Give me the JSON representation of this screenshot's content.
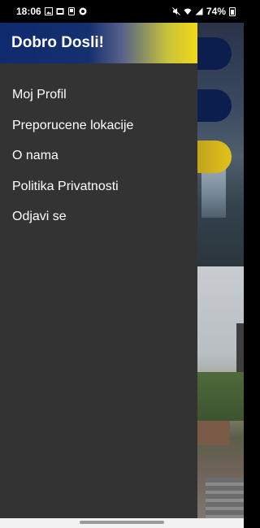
{
  "status_bar": {
    "time": "18:06",
    "battery_percent": "74%"
  },
  "drawer": {
    "title": "Dobro Dosli!",
    "items": [
      {
        "label": "Moj Profil"
      },
      {
        "label": "Preporucene lokacije"
      },
      {
        "label": "O nama"
      },
      {
        "label": "Politika Privatnosti"
      },
      {
        "label": "Odjavi se"
      }
    ]
  },
  "colors": {
    "drawer_bg": "#333333",
    "header_start": "#0f2a6e",
    "header_end": "#f2d816",
    "accent_navy": "#0b1e4d",
    "accent_yellow": "#e2c31a"
  }
}
